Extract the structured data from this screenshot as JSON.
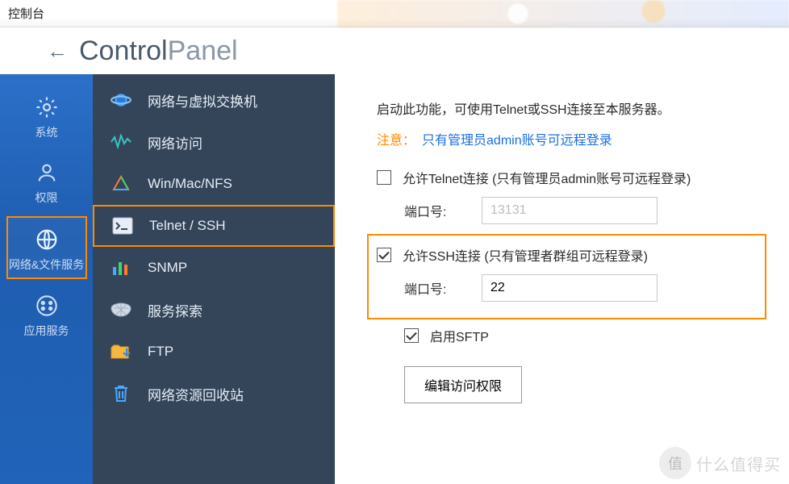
{
  "topstrip": {
    "title": "控制台"
  },
  "appbar": {
    "title_bold": "Control",
    "title_light": "Panel"
  },
  "nav1": {
    "items": [
      {
        "key": "system",
        "label": "系统"
      },
      {
        "key": "perm",
        "label": "权限"
      },
      {
        "key": "netfile",
        "label": "网络&文件服务"
      },
      {
        "key": "apps",
        "label": "应用服务"
      }
    ],
    "active": 2
  },
  "nav2": {
    "items": [
      {
        "key": "vswitch",
        "label": "网络与虚拟交换机"
      },
      {
        "key": "netaccess",
        "label": "网络访问"
      },
      {
        "key": "winmac",
        "label": "Win/Mac/NFS"
      },
      {
        "key": "telnet",
        "label": "Telnet / SSH"
      },
      {
        "key": "snmp",
        "label": "SNMP"
      },
      {
        "key": "discover",
        "label": "服务探索"
      },
      {
        "key": "ftp",
        "label": "FTP"
      },
      {
        "key": "recycle",
        "label": "网络资源回收站"
      }
    ],
    "active": 3
  },
  "content": {
    "desc": "启动此功能，可使用Telnet或SSH连接至本服务器。",
    "note_prefix": "注意：",
    "note_link": "只有管理员admin账号可远程登录",
    "telnet": {
      "label": "允许Telnet连接 (只有管理员admin账号可远程登录)",
      "checked": false,
      "port_label": "端口号:",
      "port_value": "13131"
    },
    "ssh": {
      "label": "允许SSH连接 (只有管理者群组可远程登录)",
      "checked": true,
      "port_label": "端口号:",
      "port_value": "22",
      "sftp_label": "启用SFTP",
      "sftp_checked": true
    },
    "edit_button": "编辑访问权限"
  },
  "watermark": {
    "badge": "值",
    "text": "什么值得买"
  }
}
